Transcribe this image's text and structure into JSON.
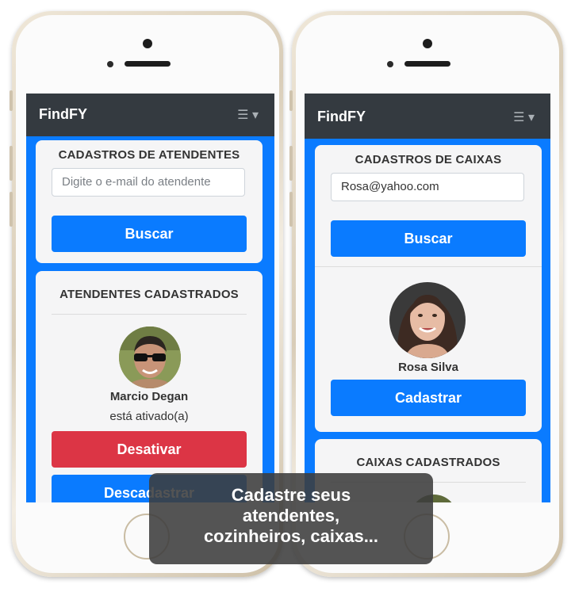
{
  "left_screen": {
    "navbar": {
      "brand": "FindFY",
      "menu_icon": "hamburger-icon"
    },
    "search_card": {
      "title": "CADASTROS DE ATENDENTES",
      "input_placeholder": "Digite o e-mail do atendente",
      "input_value": "",
      "search_button": "Buscar"
    },
    "registered_card": {
      "title": "ATENDENTES CADASTRADOS",
      "person_name": "Marcio Degan",
      "status": "está ativado(a)",
      "deactivate_button": "Desativar",
      "unregister_button": "Descadastrar"
    }
  },
  "right_screen": {
    "navbar": {
      "brand": "FindFY",
      "menu_icon": "hamburger-icon"
    },
    "search_card": {
      "title": "CADASTROS DE CAIXAS",
      "input_value": "Rosa@yahoo.com",
      "search_button": "Buscar",
      "result_name": "Rosa Silva",
      "register_button": "Cadastrar"
    },
    "registered_card": {
      "title": "CAIXAS CADASTRADOS"
    }
  },
  "caption": {
    "lines": [
      "Cadastre seus",
      "atendentes,",
      "cozinheiros, caixas..."
    ]
  },
  "colors": {
    "primary": "#0a7bff",
    "danger": "#dc3545",
    "navbar": "#343a40"
  }
}
